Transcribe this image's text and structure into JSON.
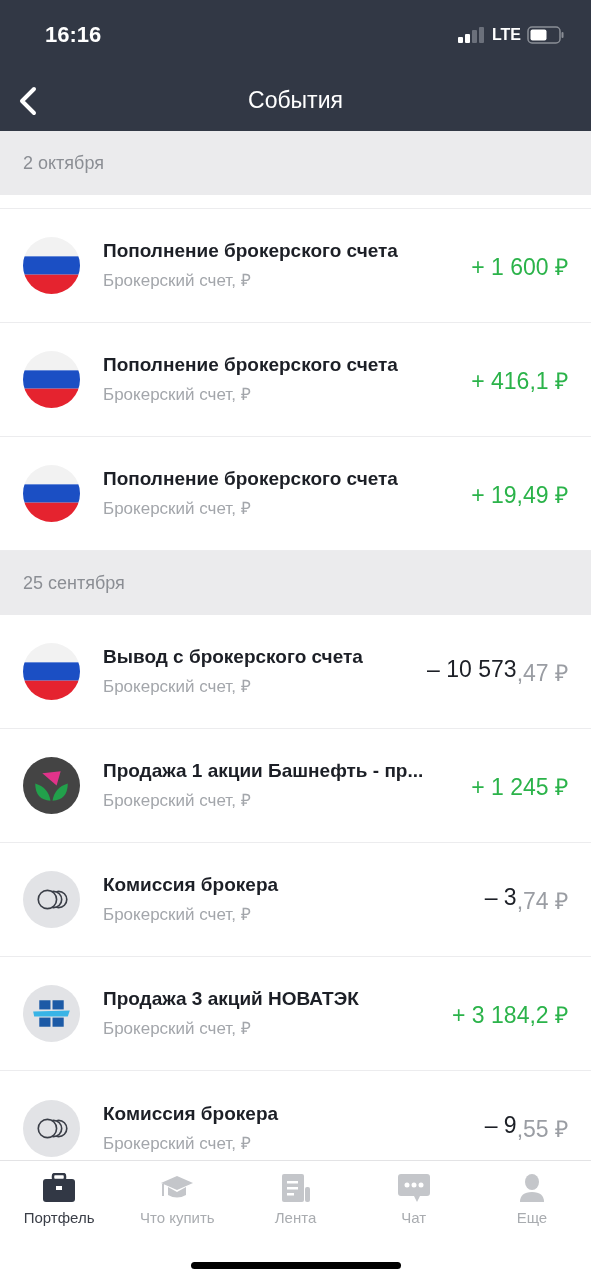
{
  "status_bar": {
    "time": "16:16",
    "network": "LTE"
  },
  "header": {
    "title": "События"
  },
  "sections": [
    {
      "date": "2 октября",
      "events": [
        {
          "kind": "flag",
          "title": "Пополнение брокерского счета",
          "account": "Брокерский счет, ₽",
          "positive": true,
          "amount": "+ 1 600 ₽"
        },
        {
          "kind": "flag",
          "title": "Пополнение брокерского счета",
          "account": "Брокерский счет, ₽",
          "positive": true,
          "amount": "+ 416,1 ₽"
        },
        {
          "kind": "flag",
          "title": "Пополнение брокерского счета",
          "account": "Брокерский счет, ₽",
          "positive": true,
          "amount": "+ 19,49 ₽"
        }
      ]
    },
    {
      "date": "25 сентября",
      "events": [
        {
          "kind": "flag",
          "title": "Вывод с брокерского счета",
          "account": "Брокерский счет, ₽",
          "positive": false,
          "amount": "– 10 573",
          "amount_fraction": ",47 ₽"
        },
        {
          "kind": "tulip",
          "title": "Продажа 1 акции Башнефть - пр...",
          "account": "Брокерский счет, ₽",
          "positive": true,
          "amount": "+ 1 245 ₽"
        },
        {
          "kind": "coins",
          "title": "Комиссия брокера",
          "account": "Брокерский счет, ₽",
          "positive": false,
          "amount": "– 3",
          "amount_fraction": ",74 ₽"
        },
        {
          "kind": "blocks",
          "title": "Продажа 3 акций НОВАТЭК",
          "account": "Брокерский счет, ₽",
          "positive": true,
          "amount": "+ 3 184,2 ₽"
        },
        {
          "kind": "coins",
          "title": "Комиссия брокера",
          "account": "Брокерский счет, ₽",
          "positive": false,
          "amount": "– 9",
          "amount_fraction": ",55 ₽"
        }
      ]
    }
  ],
  "tab_bar": [
    {
      "kind": "briefcase",
      "label": "Портфель",
      "selected": true
    },
    {
      "kind": "cap",
      "label": "Что купить",
      "selected": false
    },
    {
      "kind": "feed",
      "label": "Лента",
      "selected": false
    },
    {
      "kind": "chat",
      "label": "Чат",
      "selected": false
    },
    {
      "kind": "person",
      "label": "Еще",
      "selected": false
    }
  ]
}
